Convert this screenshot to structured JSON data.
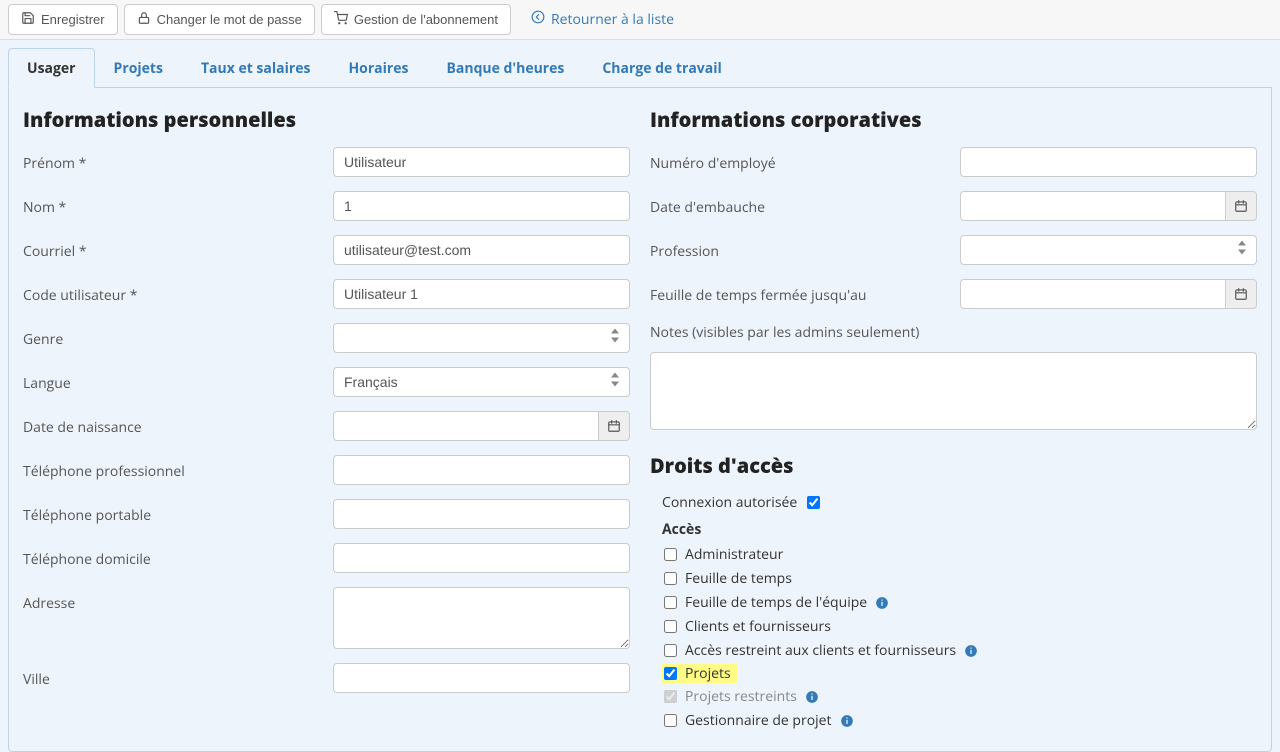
{
  "toolbar": {
    "save": "Enregistrer",
    "change_password": "Changer le mot de passe",
    "subscription": "Gestion de l'abonnement",
    "return": "Retourner à la liste"
  },
  "tabs": {
    "user": "Usager",
    "projects": "Projets",
    "rates": "Taux et salaires",
    "schedules": "Horaires",
    "timebank": "Banque d'heures",
    "workload": "Charge de travail"
  },
  "sections": {
    "personal": "Informations personnelles",
    "corporate": "Informations corporatives",
    "access_rights": "Droits d'accès"
  },
  "personal": {
    "firstname_label": "Prénom *",
    "firstname_value": "Utilisateur",
    "lastname_label": "Nom *",
    "lastname_value": "1",
    "email_label": "Courriel *",
    "email_value": "utilisateur@test.com",
    "usercode_label": "Code utilisateur *",
    "usercode_value": "Utilisateur 1",
    "gender_label": "Genre",
    "gender_value": "",
    "language_label": "Langue",
    "language_value": "Français",
    "birthdate_label": "Date de naissance",
    "phone_work_label": "Téléphone professionnel",
    "phone_mobile_label": "Téléphone portable",
    "phone_home_label": "Téléphone domicile",
    "address_label": "Adresse",
    "city_label": "Ville"
  },
  "corporate": {
    "employee_no_label": "Numéro d'employé",
    "hire_date_label": "Date d'embauche",
    "profession_label": "Profession",
    "timesheet_closed_label": "Feuille de temps fermée jusqu'au",
    "notes_label": "Notes (visibles par les admins seulement)"
  },
  "access": {
    "login_allowed_label": "Connexion autorisée",
    "login_allowed_checked": true,
    "access_head": "Accès",
    "items": [
      {
        "label": "Administrateur",
        "checked": false,
        "info": false,
        "highlight": false,
        "disabled": false
      },
      {
        "label": "Feuille de temps",
        "checked": false,
        "info": false,
        "highlight": false,
        "disabled": false
      },
      {
        "label": "Feuille de temps de l'équipe",
        "checked": false,
        "info": true,
        "highlight": false,
        "disabled": false
      },
      {
        "label": "Clients et fournisseurs",
        "checked": false,
        "info": false,
        "highlight": false,
        "disabled": false
      },
      {
        "label": "Accès restreint aux clients et fournisseurs",
        "checked": false,
        "info": true,
        "highlight": false,
        "disabled": false
      },
      {
        "label": "Projets",
        "checked": true,
        "info": false,
        "highlight": true,
        "disabled": false
      },
      {
        "label": "Projets restreints",
        "checked": true,
        "info": true,
        "highlight": false,
        "disabled": true
      },
      {
        "label": "Gestionnaire de projet",
        "checked": false,
        "info": true,
        "highlight": false,
        "disabled": false
      }
    ]
  }
}
